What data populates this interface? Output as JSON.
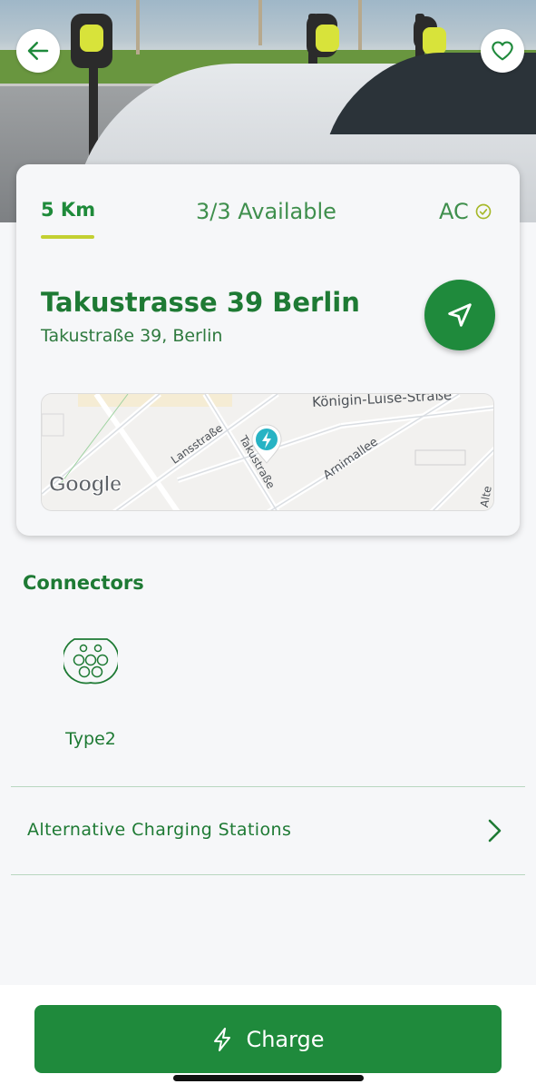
{
  "header": {
    "back_icon": "arrow-left-icon",
    "favorite_icon": "heart-icon"
  },
  "card": {
    "tabs": {
      "distance": "5 Km",
      "availability": "3/3 Available",
      "current_type": "AC",
      "current_type_icon": "check-circle-icon"
    },
    "station_name": "Takustrasse 39 Berlin",
    "station_address": "Takustraße 39, Berlin",
    "navigate_icon": "navigation-arrow-icon",
    "map": {
      "street_labels": [
        "Königin-Luise-Straße",
        "Lansstraße",
        "Takustraße",
        "Arnimallee",
        "Alte"
      ],
      "logo": "Google",
      "marker_icon": "charging-pin-icon"
    }
  },
  "connectors": {
    "title": "Connectors",
    "items": [
      {
        "label": "Type2",
        "icon": "type2-plug-icon"
      }
    ]
  },
  "alternatives": {
    "label": "Alternative Charging Stations",
    "icon": "chevron-right-icon"
  },
  "charge_button": {
    "label": "Charge",
    "icon": "lightning-icon"
  },
  "colors": {
    "brand_green": "#1f8a3c",
    "accent_lime": "#c3d032",
    "text_green": "#1e7a34",
    "background": "#f6f7f9"
  }
}
